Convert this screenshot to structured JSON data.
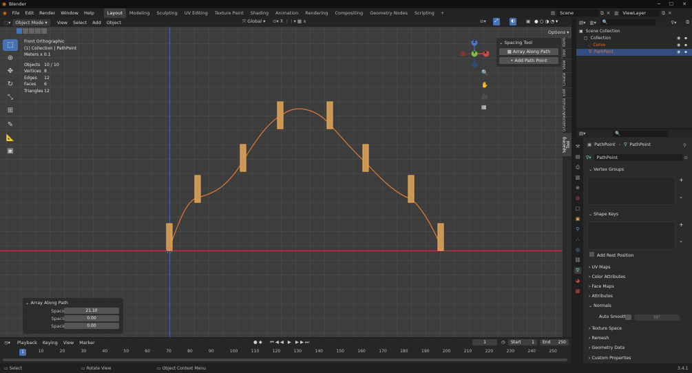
{
  "app": {
    "title": "Blender",
    "version": "3.4.1"
  },
  "menu": [
    "File",
    "Edit",
    "Render",
    "Window",
    "Help"
  ],
  "workspaces": [
    "Layout",
    "Modeling",
    "Sculpting",
    "UV Editing",
    "Texture Paint",
    "Shading",
    "Animation",
    "Rendering",
    "Compositing",
    "Geometry Nodes",
    "Scripting"
  ],
  "active_workspace": "Layout",
  "scene": {
    "name": "Scene",
    "view_layer": "ViewLayer"
  },
  "viewport_header": {
    "mode": "Object Mode",
    "menus": [
      "View",
      "Select",
      "Add",
      "Object"
    ],
    "orientation": "Global",
    "options": "Options"
  },
  "viewport_info": {
    "view": "Front Orthographic",
    "collection": "(1) Collection | PathPoint",
    "scale": "Meters x 0.1",
    "stats": [
      {
        "label": "Objects",
        "value": "10 / 10"
      },
      {
        "label": "Vertices",
        "value": "8"
      },
      {
        "label": "Edges",
        "value": "12"
      },
      {
        "label": "Faces",
        "value": "6"
      },
      {
        "label": "Triangles",
        "value": "12"
      }
    ]
  },
  "gizmo": {
    "x": "X",
    "y": "Y",
    "z": "Z"
  },
  "npanel": {
    "title": "Spacing Tool",
    "buttons": [
      "Array Along Path",
      "Add Path Point"
    ],
    "tabs": [
      "Item",
      "Tool",
      "View",
      "Create",
      "Edit",
      "Animate",
      "GrabDoc",
      "Spacing Tool"
    ],
    "active_tab": "Spacing Tool"
  },
  "operator_panel": {
    "title": "Array Along Path",
    "fields": [
      {
        "label": "Spacing X Axis",
        "value": "21.10"
      },
      {
        "label": "Spacing Y Axis",
        "value": "0.00"
      },
      {
        "label": "Spacing Z Axis",
        "value": "0.00"
      }
    ]
  },
  "outliner": {
    "items": [
      {
        "name": "Scene Collection",
        "indent": 0,
        "color": "#d0d0d0",
        "selected": false
      },
      {
        "name": "Collection",
        "indent": 1,
        "color": "#d0d0d0",
        "selected": false
      },
      {
        "name": "Curve",
        "indent": 2,
        "color": "#e07a3a",
        "selected": false
      },
      {
        "name": "PathPoint",
        "indent": 2,
        "color": "#e07a3a",
        "selected": true
      }
    ]
  },
  "properties": {
    "breadcrumb": [
      "PathPoint",
      "PathPoint"
    ],
    "mesh_name": "PathPoint",
    "sections": [
      "Vertex Groups",
      "Shape Keys",
      "Add Rest Position",
      "UV Maps",
      "Color Attributes",
      "Face Maps",
      "Attributes",
      "Normals",
      "Auto Smooth",
      "Texture Space",
      "Remesh",
      "Geometry Data",
      "Custom Properties"
    ],
    "auto_smooth_angle": "30°"
  },
  "timeline": {
    "menus": [
      "Playback",
      "Keying",
      "View",
      "Marker"
    ],
    "current_frame": "1",
    "start_label": "Start",
    "start": "1",
    "end_label": "End",
    "end": "250",
    "ruler": [
      "1",
      "10",
      "20",
      "30",
      "40",
      "50",
      "60",
      "70",
      "80",
      "90",
      "100",
      "110",
      "120",
      "130",
      "140",
      "150",
      "160",
      "170",
      "180",
      "190",
      "200",
      "210",
      "220",
      "230",
      "240",
      "250"
    ]
  },
  "status": {
    "select": "Select",
    "rotate": "Rotate View",
    "context": "Object Context Menu"
  },
  "colors": {
    "accent": "#4772b3",
    "object_orange": "#e07a3a",
    "bar_fill": "#c9975a",
    "x_axis": "#b04545",
    "z_axis": "#3f67b0"
  }
}
